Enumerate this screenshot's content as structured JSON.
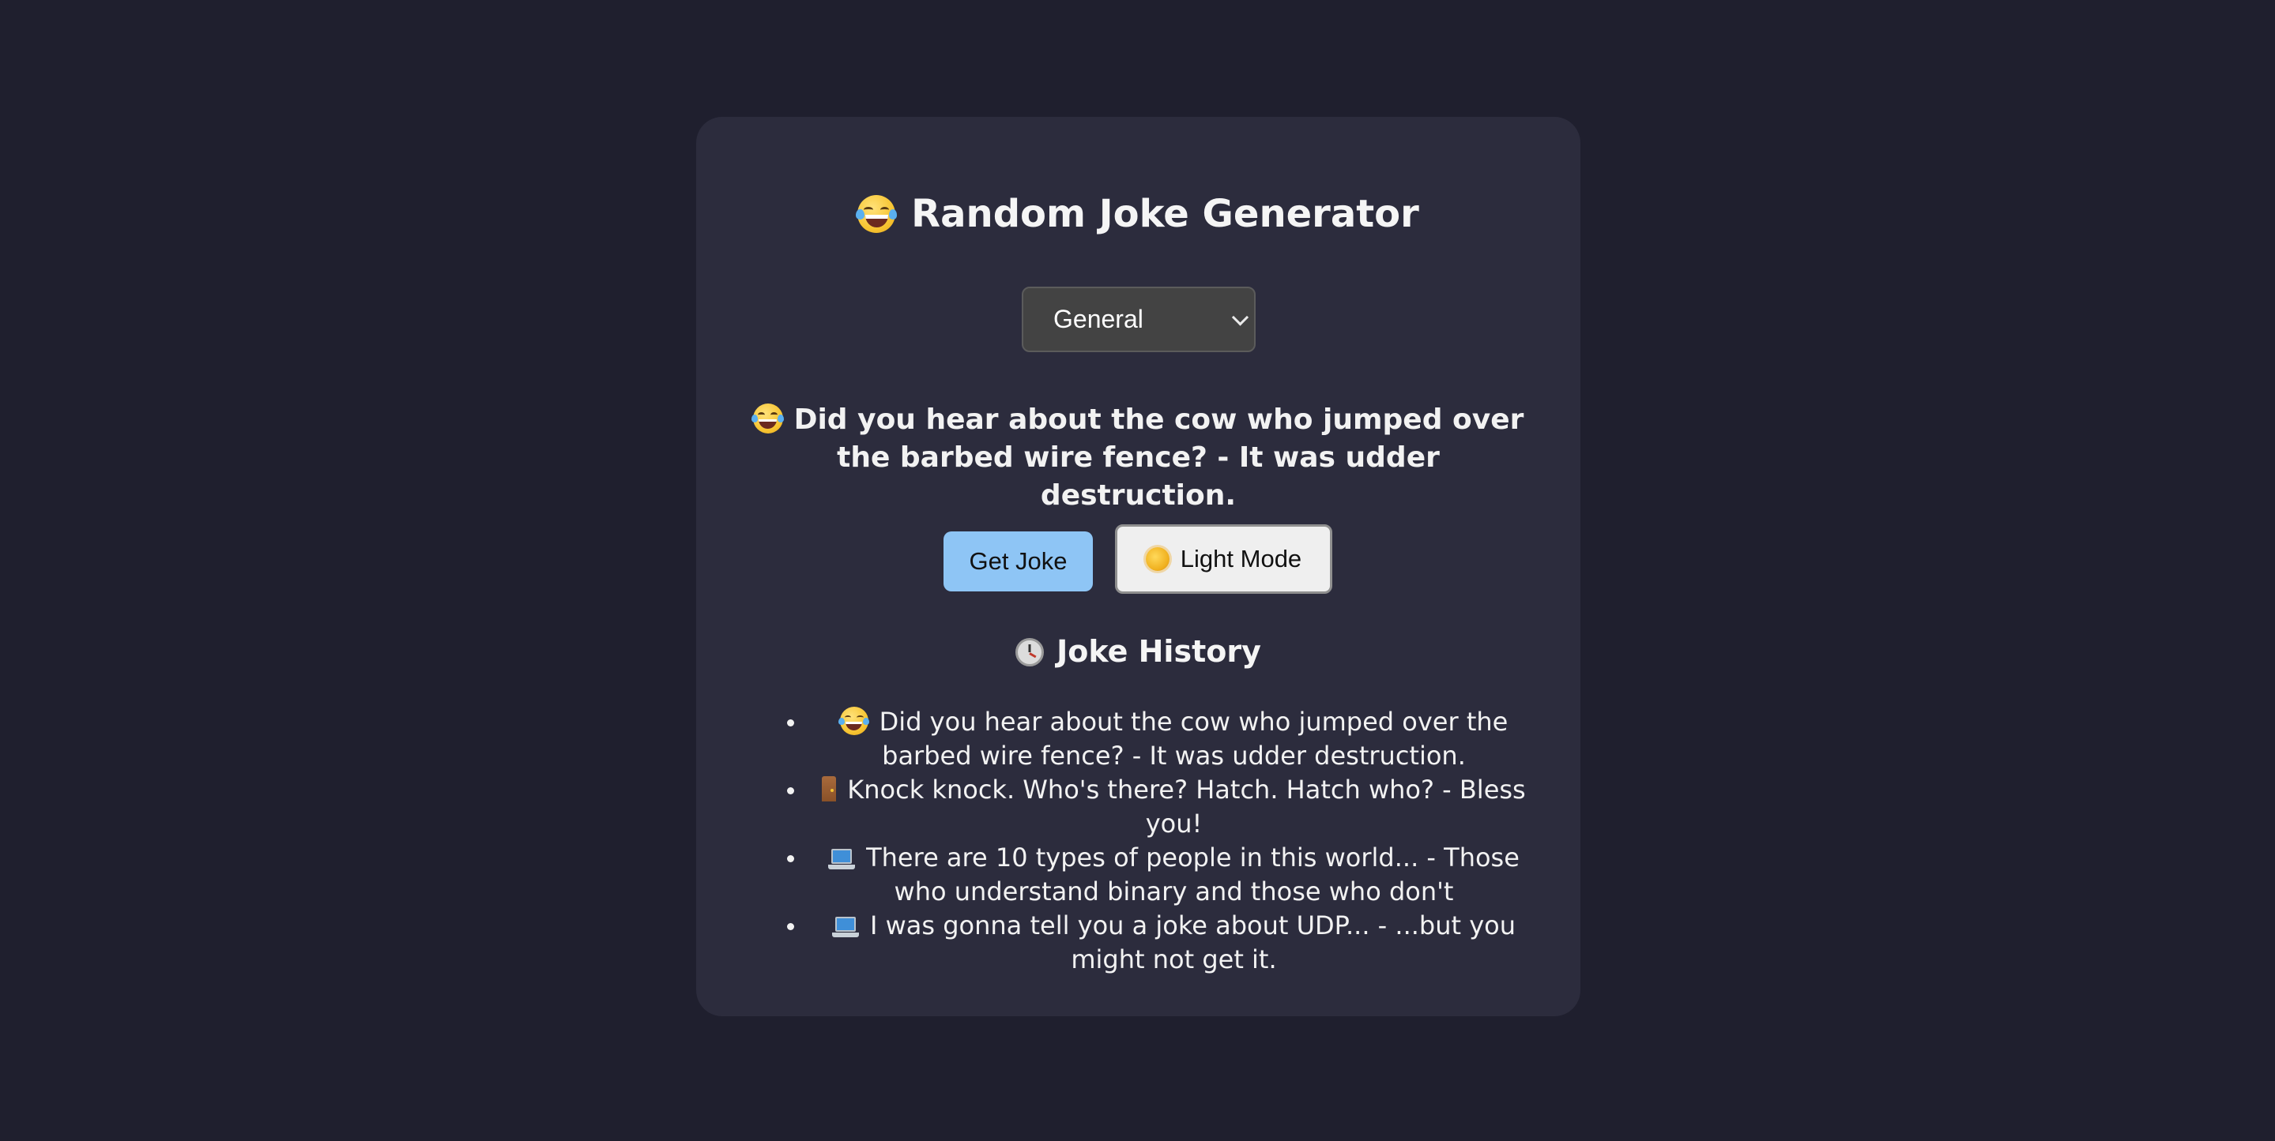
{
  "app": {
    "title": "Random Joke Generator",
    "title_icon": "laughing-face-icon"
  },
  "category_select": {
    "selected": "General",
    "icon": "chevron-down-icon"
  },
  "current_joke": {
    "icon": "laughing-face-icon",
    "text": "Did you hear about the cow who jumped over the barbed wire fence? - It was udder destruction."
  },
  "buttons": {
    "get_joke": "Get Joke",
    "light_mode": "Light Mode",
    "light_mode_icon": "sun-icon",
    "get_joke_color": "#8ec5f5"
  },
  "history": {
    "title": "Joke History",
    "title_icon": "clock-icon",
    "items": [
      {
        "icon": "laughing-face-icon",
        "text": "Did you hear about the cow who jumped over the barbed wire fence? - It was udder destruction."
      },
      {
        "icon": "door-icon",
        "text": "Knock knock. Who's there? Hatch. Hatch who? - Bless you!"
      },
      {
        "icon": "laptop-icon",
        "text": "There are 10 types of people in this world... - Those who understand binary and those who don't"
      },
      {
        "icon": "laptop-icon",
        "text": "I was gonna tell you a joke about UDP... - ...but you might not get it."
      }
    ]
  },
  "colors": {
    "page_background": "#1f1f2e",
    "card_background": "#2c2c3d",
    "text": "#f2f2f2"
  }
}
